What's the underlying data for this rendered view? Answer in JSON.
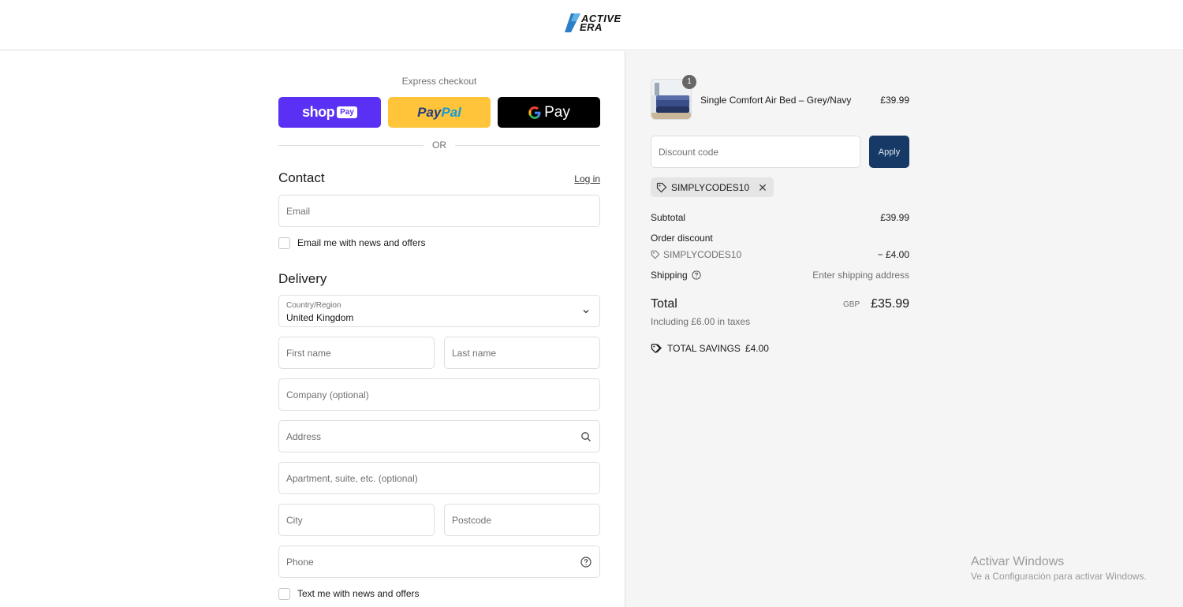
{
  "brand": {
    "logo_line1": "ACTIVE",
    "logo_line2": "ERA"
  },
  "express": {
    "title": "Express checkout",
    "shop_pay_label": "shop",
    "shop_pay_badge": "Pay",
    "paypal_label_1": "Pay",
    "paypal_label_2": "Pal",
    "gpay_label": "Pay",
    "or_label": "OR"
  },
  "contact": {
    "title": "Contact",
    "login_link": "Log in",
    "email_placeholder": "Email",
    "email_optin_label": "Email me with news and offers"
  },
  "delivery": {
    "title": "Delivery",
    "country_label": "Country/Region",
    "country_value": "United Kingdom",
    "first_name_placeholder": "First name",
    "last_name_placeholder": "Last name",
    "company_placeholder": "Company (optional)",
    "address_placeholder": "Address",
    "apartment_placeholder": "Apartment, suite, etc. (optional)",
    "city_placeholder": "City",
    "postcode_placeholder": "Postcode",
    "phone_placeholder": "Phone",
    "text_optin_label": "Text me with news and offers"
  },
  "order": {
    "product_name": "Single Comfort Air Bed – Grey/Navy",
    "product_price": "£39.99",
    "quantity": "1",
    "discount_placeholder": "Discount code",
    "apply_label": "Apply",
    "applied_code": "SIMPLYCODES10",
    "subtotal_label": "Subtotal",
    "subtotal_value": "£39.99",
    "order_discount_label": "Order discount",
    "discount_code_line": "SIMPLYCODES10",
    "discount_value": "− £4.00",
    "shipping_label": "Shipping",
    "shipping_value": "Enter shipping address",
    "total_label": "Total",
    "total_currency": "GBP",
    "total_value": "£35.99",
    "taxes_note": "Including £6.00 in taxes",
    "savings_label": "TOTAL SAVINGS",
    "savings_value": "£4.00"
  },
  "os_watermark": {
    "line1": "Activar Windows",
    "line2": "Ve a Configuración para activar Windows."
  },
  "colors": {
    "shop_pay": "#5a31f4",
    "paypal": "#ffc439",
    "gpay": "#000000",
    "apply_button": "#163966",
    "summary_bg": "#f5f5f5"
  }
}
